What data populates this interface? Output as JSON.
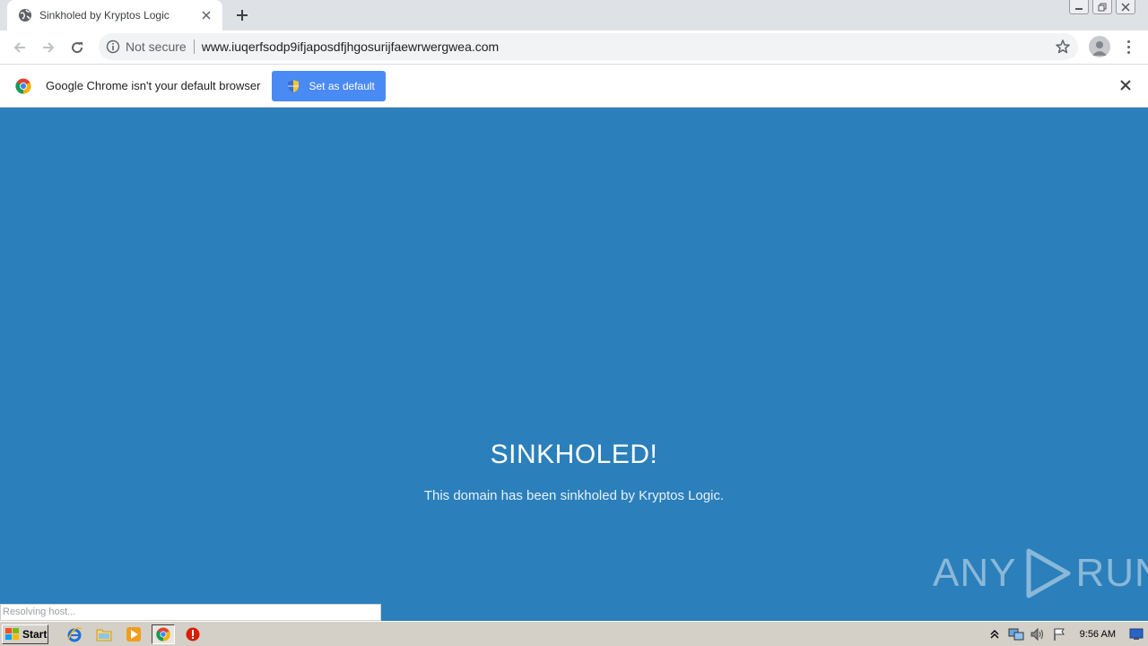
{
  "browser": {
    "tab": {
      "title": "Sinkholed by Kryptos Logic"
    },
    "toolbar": {
      "security_label": "Not secure",
      "url": "www.iuqerfsodp9ifjaposdfjhgosurijfaewrwergwea.com"
    },
    "infobar": {
      "message": "Google Chrome isn't your default browser",
      "button_label": "Set as default"
    }
  },
  "page": {
    "headline": "SINKHOLED!",
    "message": "This domain has been sinkholed by Kryptos Logic.",
    "watermark_left": "ANY",
    "watermark_right": "RUN"
  },
  "status_bar": {
    "text": "Resolving host..."
  },
  "taskbar": {
    "start_label": "Start",
    "clock": "9:56 AM"
  },
  "colors": {
    "page_background": "#2b7fbb",
    "infobar_button": "#4a8af4",
    "tabstrip": "#dee1e6",
    "taskbar": "#d4d0c8"
  },
  "icons": [
    "globe-icon",
    "close-icon",
    "plus-icon",
    "back-arrow-icon",
    "forward-arrow-icon",
    "reload-icon",
    "info-icon",
    "star-icon",
    "profile-icon",
    "menu-icon",
    "chrome-logo-icon",
    "shield-icon",
    "windows-logo-icon",
    "ie-icon",
    "folder-icon",
    "media-player-icon",
    "chrome-icon",
    "stop-icon",
    "up-arrow-icon",
    "network-icon",
    "speaker-icon",
    "flag-icon",
    "show-desktop-icon"
  ]
}
